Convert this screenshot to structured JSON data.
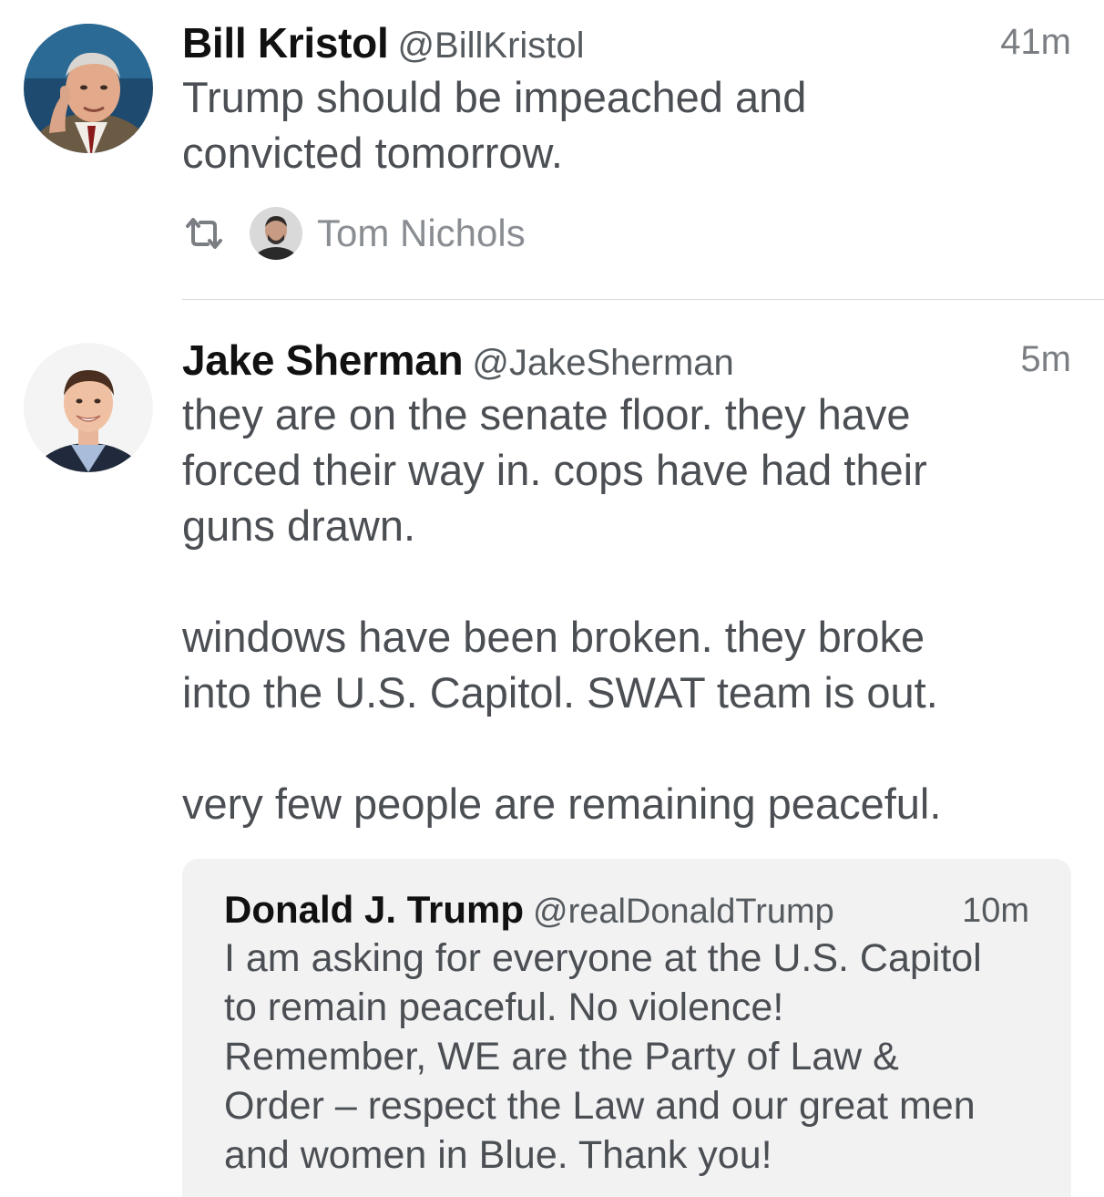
{
  "tweets": [
    {
      "name": "Bill Kristol",
      "handle": "@BillKristol",
      "time": "41m",
      "text": "Trump should be impeached and\nconvicted tomorrow.",
      "retweeted_by": "Tom Nichols"
    },
    {
      "name": "Jake Sherman",
      "handle": "@JakeSherman",
      "time": "5m",
      "text": "they are on the senate floor. they have\nforced their way in. cops have had their\nguns drawn.\n\nwindows have been broken. they broke\ninto the U.S. Capitol. SWAT team is out.\n\nvery few people are remaining peaceful.",
      "quote": {
        "name": "Donald J. Trump",
        "handle": "@realDonaldTrump",
        "time": "10m",
        "text": "I am asking for everyone at the U.S. Capitol\nto remain peaceful. No violence!\nRemember, WE are the Party of Law &\nOrder – respect the Law and our great men\nand women in Blue. Thank you!"
      }
    }
  ],
  "icons": {
    "retweet": "retweet-icon"
  },
  "colors": {
    "name": "#111111",
    "body": "#4b4f54",
    "meta": "#7a7e83",
    "quote_bg": "#f2f2f3",
    "divider": "#d9dcdf"
  }
}
